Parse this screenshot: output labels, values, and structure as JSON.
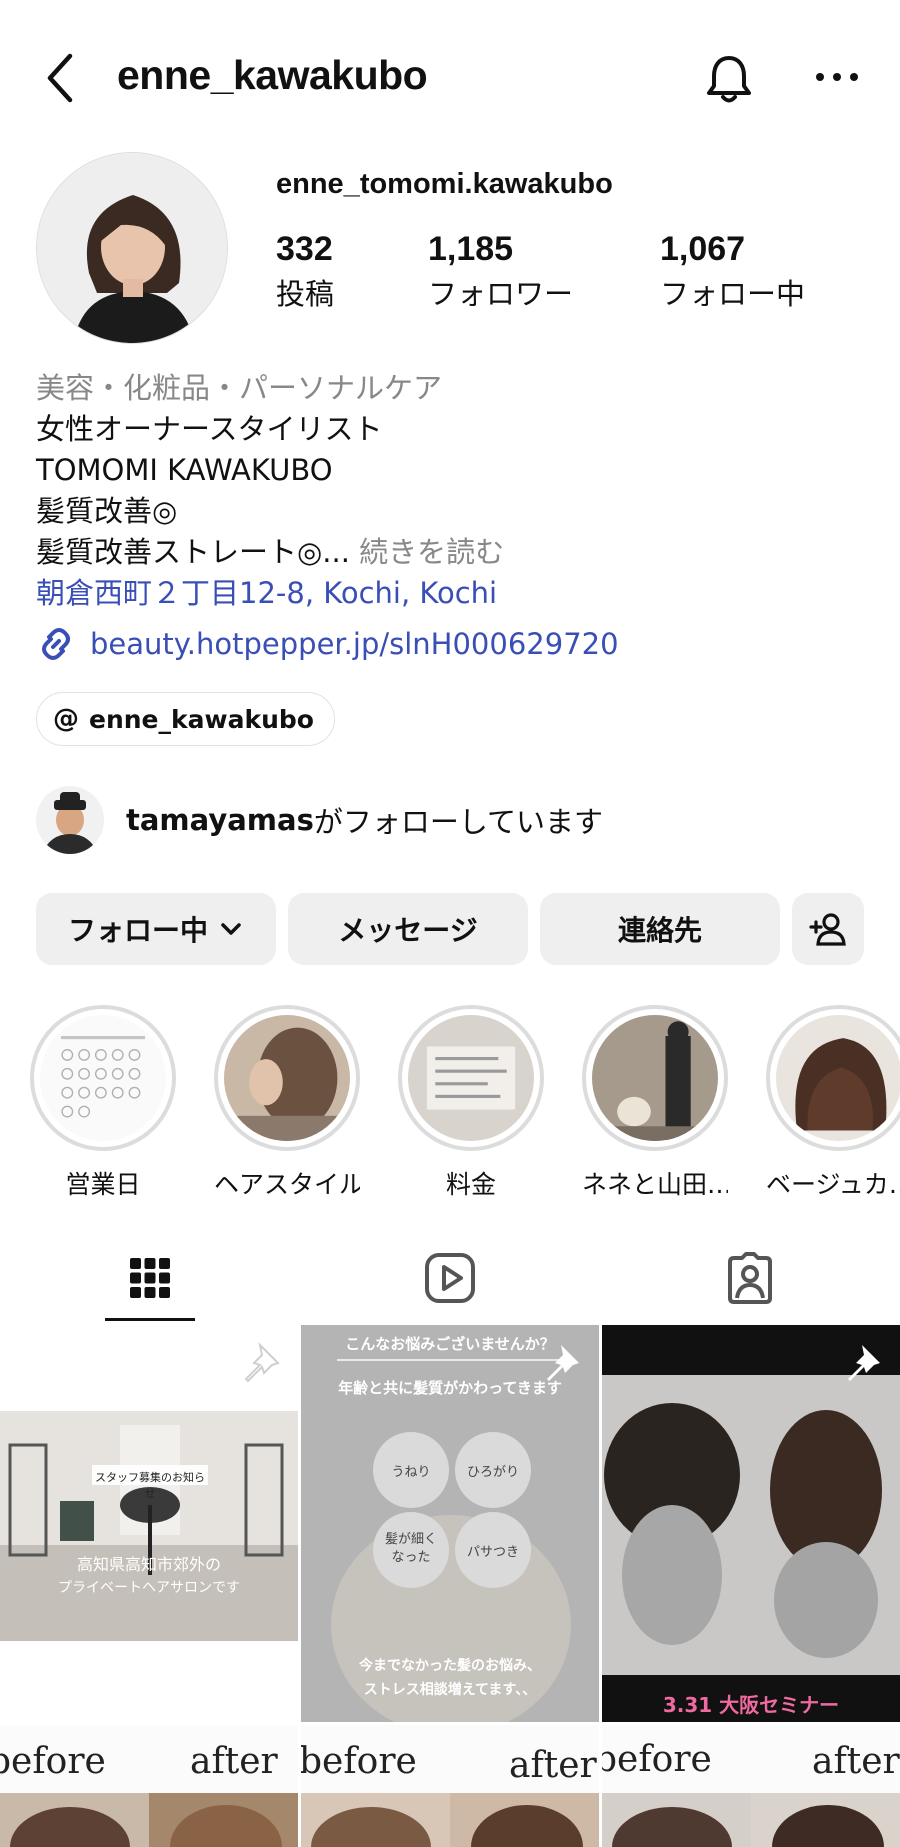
{
  "header": {
    "username": "enne_kawakubo"
  },
  "profile": {
    "full_name": "enne_tomomi.kawakubo",
    "stats": [
      {
        "value": "332",
        "label": "投稿"
      },
      {
        "value": "1,185",
        "label": "フォロワー"
      },
      {
        "value": "1,067",
        "label": "フォロー中"
      }
    ],
    "bio": {
      "category": "美容・化粧品・パーソナルケア",
      "line1": "女性オーナースタイリスト",
      "line2": "TOMOMI KAWAKUBO",
      "line3": "髪質改善◎",
      "line4": "髪質改善ストレート◎...",
      "more": " 続きを読む",
      "location": "朝倉西町２丁目12-8, Kochi, Kochi"
    },
    "link": "beauty.hotpepper.jp/slnH000629720",
    "threads_handle": "enne_kawakubo",
    "followed_by": {
      "user": "tamayamas",
      "text": "がフォローしています"
    }
  },
  "actions": {
    "following": "フォロー中",
    "message": "メッセージ",
    "contact": "連絡先"
  },
  "highlights": [
    {
      "label": "営業日"
    },
    {
      "label": "ヘアスタイル"
    },
    {
      "label": "料金"
    },
    {
      "label": "ネネと山田…"
    },
    {
      "label": "ベージュカ…"
    }
  ],
  "posts": {
    "p1": {
      "banner": "スタッフ募集のお知らせ",
      "line1": "高知県高知市郊外の",
      "line2": "プライベートヘアサロンです"
    },
    "p2": {
      "top": "こんなお悩みございませんか？",
      "sub": "年齢と共に髪質がかわってきます",
      "bubbles": [
        "うねり",
        "ひろがり",
        "髪が細く なった",
        "パサつき"
      ],
      "bottom1": "今までなかった髪のお悩み、",
      "bottom2": "ストレス相談増えてます、、"
    },
    "p3": {
      "caption": "3.31 大阪セミナー"
    },
    "row2": [
      {
        "before": "before",
        "after": "after"
      },
      {
        "before": "before",
        "after": "after"
      },
      {
        "before": "before",
        "after": "after"
      }
    ]
  }
}
